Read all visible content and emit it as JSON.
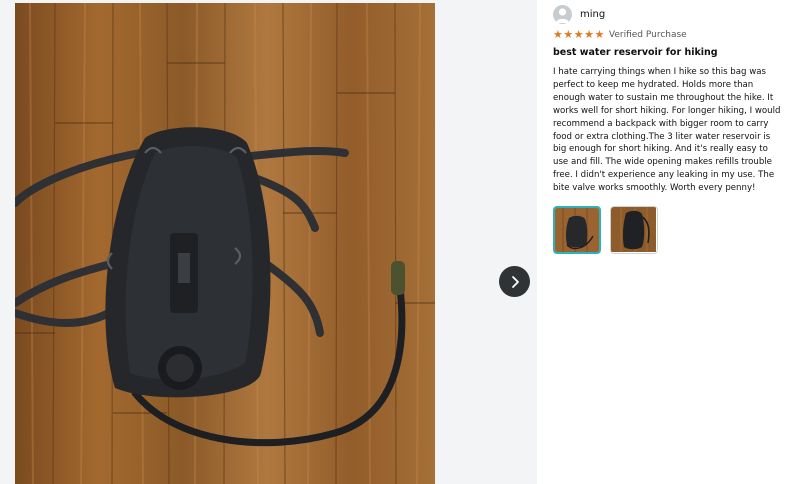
{
  "reviewer": {
    "name": "ming",
    "avatar_icon": "user-silhouette-icon"
  },
  "rating": {
    "stars": 5,
    "max": 5,
    "star_color": "#de7921"
  },
  "verified_label": "Verified Purchase",
  "review_title": "best water reservoir for hiking",
  "review_body": "I hate carrying things when I hike so this bag was perfect to keep me hydrated. Holds more than enough water to sustain me throughout the hike. It works well for short hiking. For longer hiking, I would recommend a backpack with bigger room to carry food or extra clothing.The 3 liter water reservoir is big enough for short hiking. And it's really easy to use and fill. The wide opening makes refills trouble free. I didn't experience any leaking in my use. The bite valve works smoothly. Worth every penny!",
  "gallery": {
    "next_icon": "chevron-right-icon",
    "thumbnails": [
      {
        "label": "photo-1",
        "selected": true
      },
      {
        "label": "photo-2",
        "selected": false
      }
    ]
  },
  "colors": {
    "thumb_selected_border": "#2bb3ba",
    "next_button": "#2f3335"
  }
}
